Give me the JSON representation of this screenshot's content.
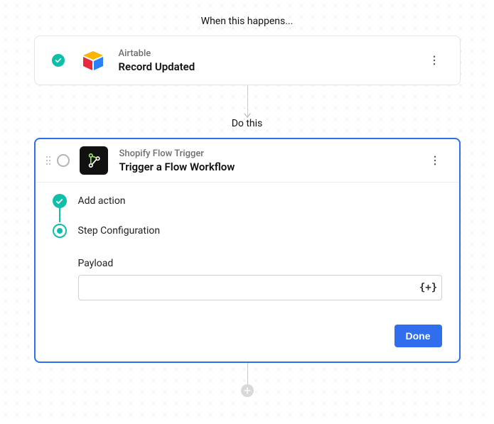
{
  "labels": {
    "when": "When this happens...",
    "do": "Do this"
  },
  "trigger": {
    "app_name": "Airtable",
    "event_name": "Record Updated"
  },
  "action": {
    "app_name": "Shopify Flow Trigger",
    "event_name": "Trigger a Flow Workflow",
    "steps": {
      "add_action": "Add action",
      "step_config": "Step Configuration"
    },
    "field": {
      "payload_label": "Payload",
      "payload_value": "",
      "payload_placeholder": "",
      "insert_token_glyph": "{+}"
    },
    "done_button": "Done"
  }
}
